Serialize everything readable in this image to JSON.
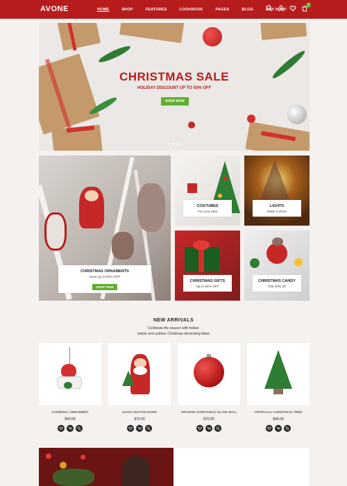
{
  "header": {
    "logo": "AVONE",
    "nav": [
      "HOME",
      "SHOP",
      "FEATURES",
      "LOOKBOOK",
      "PAGES",
      "BLOG",
      "BUY NOW!"
    ],
    "icons": [
      "search-icon",
      "user-icon",
      "heart-icon",
      "cart-icon"
    ],
    "cart_count": "0",
    "accent": "#b71c1c"
  },
  "hero": {
    "title": "CHRISTMAS SALE",
    "subtitle": "HOLIDAY DISCOUNT UP TO 50% OFF",
    "button": "SHOP NOW",
    "button_color": "#5fae2e"
  },
  "collections": {
    "ornaments": {
      "title": "CHRISTMAS ORNAMENTS",
      "sub": "Save up to 50% OFF",
      "button": "SHOP NOW"
    },
    "costumes": {
      "title": "COSTUMES",
      "sub": "For your pets"
    },
    "lights": {
      "title": "LIGHTS",
      "sub": "Make it shine"
    },
    "gifts": {
      "title": "CHRISTMAS GIFTS",
      "sub": "Up to 60% OFF"
    },
    "candy": {
      "title": "CHRISTMAS CANDY",
      "sub": "Flat 30% off"
    }
  },
  "arrivals": {
    "title": "NEW ARRIVALS",
    "desc1": "Celebrate the season with festive",
    "desc2": "indoor and outdoor Christmas decorating ideas",
    "products": [
      {
        "name": "CARDINAL ORNAMENT",
        "price": "$50.00"
      },
      {
        "name": "SANTA NUTCRACKER",
        "price": "$70.00"
      },
      {
        "name": "ORANGE CHRISTMAS GLASS BALL",
        "price": "$70.00"
      },
      {
        "name": "ARTIFICIAL CHRISTMAS TREE",
        "price": "$40.00"
      }
    ]
  }
}
